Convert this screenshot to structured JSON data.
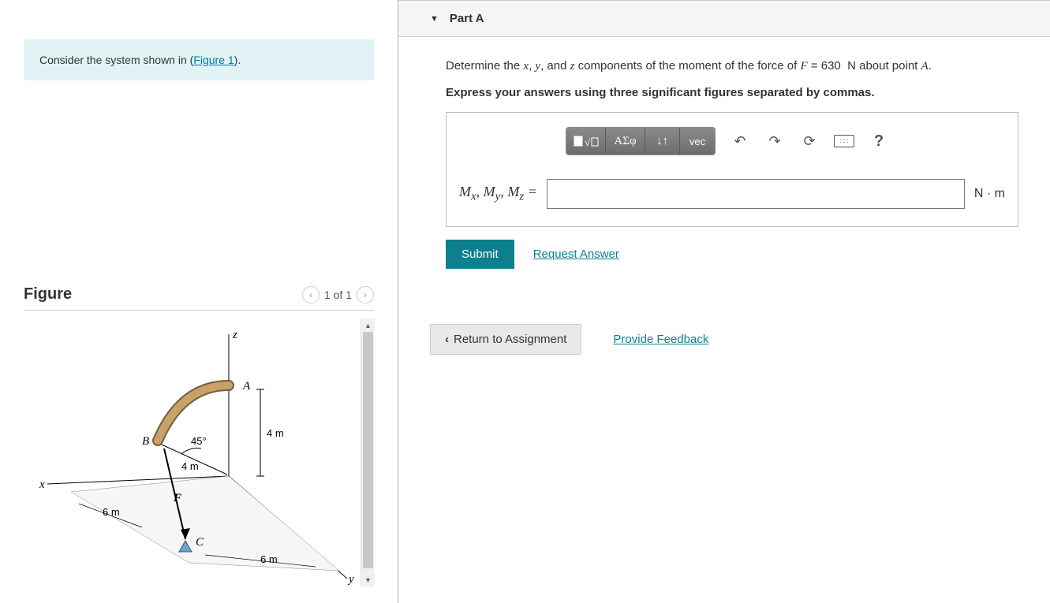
{
  "instruction": {
    "prefix": "Consider the system shown in (",
    "link": "Figure 1",
    "suffix": ")."
  },
  "figure": {
    "title": "Figure",
    "page_label": "1 of 1",
    "labels": {
      "x": "x",
      "y": "y",
      "z": "z",
      "A": "A",
      "B": "B",
      "C": "C",
      "F": "F",
      "angle": "45°",
      "d1": "4 m",
      "d2": "4 m",
      "d3": "6 m",
      "d4": "6 m"
    }
  },
  "part": {
    "title": "Part A",
    "question_pre": "Determine the ",
    "vars": "x, y, ",
    "vars_and": "and ",
    "var_z": "z",
    "question_mid": " components of the moment of the force of ",
    "F_eq": "F = 630  N",
    "question_post": " about point ",
    "pointA": "A",
    "period": ".",
    "instruct": "Express your answers using three significant figures separated by commas.",
    "var_label": "Mₓ, Mᵧ, M_z =",
    "unit": "N · m",
    "submit": "Submit",
    "request_answer": "Request Answer"
  },
  "toolbar": {
    "templates": "∎√□",
    "greek": "ΑΣφ",
    "subsup": "↓↑",
    "vec": "vec",
    "undo": "↶",
    "redo": "↷",
    "reset": "⟳",
    "keyboard": "⌨",
    "help": "?"
  },
  "footer": {
    "return": "Return to Assignment",
    "feedback": "Provide Feedback"
  }
}
